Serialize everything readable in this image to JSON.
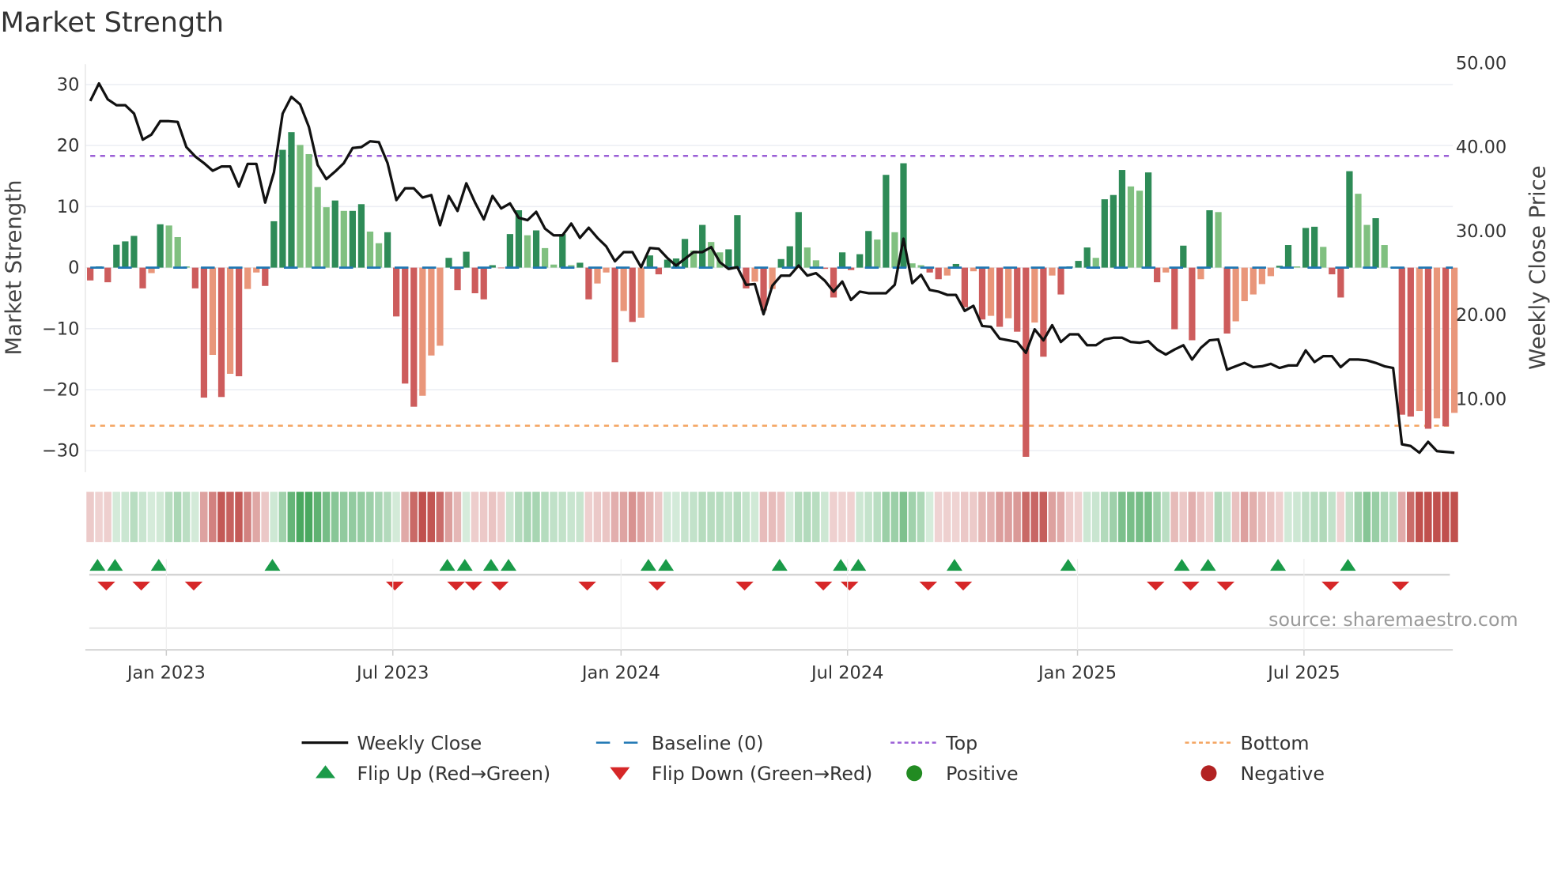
{
  "chart_data": {
    "type": "bar",
    "title": "Market Strength",
    "ylabel": "Market Strength",
    "y2label": "Weekly Close Price",
    "ylim": [
      -33,
      33
    ],
    "y2lim": [
      0,
      52
    ],
    "yticks": [
      30,
      20,
      10,
      0,
      -10,
      -20,
      -30
    ],
    "ytick_labels": [
      "30",
      "20",
      "10",
      "0",
      "−10",
      "−20",
      "−30"
    ],
    "y2ticks": [
      50,
      40,
      30,
      20,
      10
    ],
    "y2tick_labels": [
      "50.00",
      "40.00",
      "30.00",
      "20.00",
      "10.00"
    ],
    "xticks": [
      {
        "label": "Jan 2023",
        "week": 8.7
      },
      {
        "label": "Jul 2023",
        "week": 34.6
      },
      {
        "label": "Jan 2024",
        "week": 60.7
      },
      {
        "label": "Jul 2024",
        "week": 86.6
      },
      {
        "label": "Jan 2025",
        "week": 112.9
      },
      {
        "label": "Jul 2025",
        "week": 138.8
      }
    ],
    "top_level": 18.3,
    "bottom_level": -25.9,
    "grid": true,
    "legend_placement": "bottom",
    "strength": [
      -2.1,
      0.2,
      -2.4,
      3.75,
      4.3,
      5.2,
      -3.4,
      -0.9,
      7.1,
      6.9,
      5.0,
      0.2,
      -3.4,
      -21.3,
      -14.3,
      -21.2,
      -17.4,
      -17.8,
      -3.5,
      -0.8,
      -3.0,
      7.6,
      19.3,
      22.2,
      20.1,
      18.6,
      13.2,
      9.9,
      11.0,
      9.3,
      9.3,
      10.4,
      5.9,
      4.0,
      5.8,
      -8.0,
      -19.0,
      -22.8,
      -21.0,
      -14.4,
      -12.8,
      1.6,
      -3.7,
      2.6,
      -4.2,
      -5.2,
      0.4,
      -0.1,
      5.5,
      9.4,
      5.3,
      6.1,
      3.2,
      0.5,
      5.5,
      0.4,
      0.8,
      -5.2,
      -2.6,
      -0.8,
      -15.5,
      -7.1,
      -8.9,
      -8.2,
      2.0,
      -1.1,
      1.3,
      1.5,
      4.7,
      2.8,
      7.0,
      4.2,
      2.5,
      3.0,
      8.6,
      -3.4,
      -2.3,
      -7.0,
      -3.5,
      1.4,
      3.5,
      9.1,
      3.3,
      1.2,
      -0.2,
      -4.9,
      2.5,
      -0.4,
      2.2,
      6.0,
      4.6,
      15.2,
      5.8,
      17.1,
      0.7,
      0.4,
      -0.8,
      -1.9,
      -1.3,
      0.6,
      -6.5,
      -0.6,
      -8.5,
      -7.9,
      -9.7,
      -8.3,
      -10.5,
      -31.0,
      -9.0,
      -14.6,
      -1.3,
      -4.4,
      0.2,
      1.1,
      3.3,
      1.6,
      11.2,
      11.9,
      16.0,
      13.3,
      12.6,
      15.6,
      -2.4,
      -0.8,
      -10.1,
      3.6,
      -11.9,
      -1.9,
      9.4,
      9.1,
      -10.8,
      -8.8,
      -5.5,
      -4.4,
      -2.7,
      -1.4,
      0.3,
      3.7,
      0.2,
      6.5,
      6.7,
      3.4,
      -1.1,
      -4.9,
      15.8,
      12.1,
      7.0,
      8.1,
      3.7,
      0.1,
      -24.1,
      -24.4,
      -23.5,
      -26.4,
      -24.7,
      -26.0,
      -23.8
    ],
    "weekly_close": [
      46.2,
      48.3,
      46.4,
      45.7,
      45.7,
      44.7,
      41.6,
      42.2,
      43.8,
      43.8,
      43.7,
      40.7,
      39.6,
      38.8,
      37.9,
      38.4,
      38.4,
      36.0,
      38.7,
      38.7,
      34.1,
      37.7,
      44.7,
      46.7,
      45.8,
      43.1,
      38.6,
      36.9,
      37.8,
      38.8,
      40.6,
      40.7,
      41.4,
      41.3,
      38.8,
      34.4,
      35.8,
      35.8,
      34.7,
      35.0,
      31.4,
      34.9,
      33.1,
      36.4,
      34.1,
      32.1,
      34.9,
      33.4,
      34.0,
      32.3,
      32.0,
      33.0,
      31.0,
      30.2,
      30.2,
      31.6,
      29.9,
      31.1,
      29.9,
      28.9,
      27.1,
      28.2,
      28.2,
      26.4,
      28.7,
      28.6,
      27.5,
      26.6,
      27.4,
      28.2,
      28.2,
      28.8,
      27.0,
      26.2,
      26.4,
      24.3,
      24.4,
      20.8,
      24.2,
      25.4,
      25.4,
      26.6,
      25.4,
      25.7,
      24.8,
      23.5,
      24.7,
      22.5,
      23.5,
      23.3,
      23.3,
      23.3,
      24.3,
      29.8,
      24.5,
      25.5,
      23.7,
      23.5,
      23.1,
      23.1,
      21.2,
      21.8,
      19.4,
      19.3,
      17.9,
      17.7,
      17.5,
      16.2,
      19.0,
      17.7,
      19.5,
      17.5,
      18.4,
      18.4,
      17.1,
      17.1,
      17.8,
      18.0,
      18.0,
      17.5,
      17.4,
      17.6,
      16.6,
      16.0,
      16.6,
      17.1,
      15.4,
      16.8,
      17.7,
      17.8,
      14.2,
      14.6,
      15.0,
      14.5,
      14.6,
      14.9,
      14.4,
      14.7,
      14.7,
      16.5,
      15.1,
      15.8,
      15.8,
      14.5,
      15.4,
      15.4,
      15.3,
      15.0,
      14.6,
      14.4,
      5.3,
      5.1,
      4.3,
      5.6,
      4.5,
      4.4,
      4.3
    ],
    "flip_up_weeks": [
      1,
      3,
      8,
      21,
      41,
      43,
      46,
      48,
      64,
      66,
      79,
      86,
      88,
      99,
      112,
      125,
      128,
      136,
      144
    ],
    "flip_down_weeks": [
      2,
      6,
      12,
      35,
      42,
      44,
      47,
      57,
      65,
      75,
      84,
      87,
      96,
      100,
      122,
      126,
      130,
      142,
      150
    ],
    "legend": [
      {
        "key": "close",
        "label": "Weekly Close"
      },
      {
        "key": "baseline",
        "label": "Baseline (0)"
      },
      {
        "key": "top",
        "label": "Top"
      },
      {
        "key": "bottom",
        "label": "Bottom"
      },
      {
        "key": "flipup",
        "label": "Flip Up (Red→Green)"
      },
      {
        "key": "flipdown",
        "label": "Flip Down (Green→Red)"
      },
      {
        "key": "positive",
        "label": "Positive"
      },
      {
        "key": "negative",
        "label": "Negative"
      }
    ],
    "source": "source: sharemaestro.com"
  },
  "colors": {
    "up_strong": "#2e8b57",
    "up_weak": "#80c080",
    "down_strong": "#cd5c5c",
    "down_weak": "#e9967a",
    "baseline": "#1f77b4",
    "top": "#9b5fd6",
    "bottom": "#f4a460",
    "close": "#111111",
    "flip_up": "#1a9a48",
    "flip_down": "#d62728",
    "positive": "#228b22",
    "negative": "#b22222"
  }
}
